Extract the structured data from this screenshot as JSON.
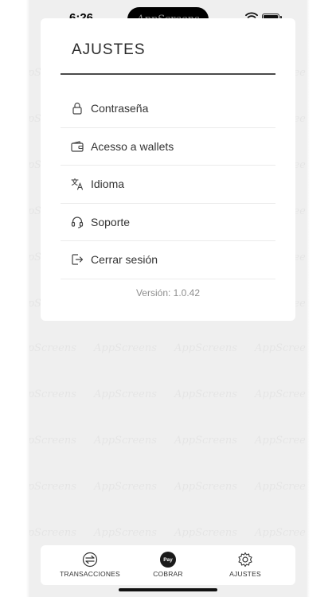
{
  "status_bar": {
    "time": "6:26",
    "island_text": "AppScreens"
  },
  "watermark": {
    "text": "AppScreens"
  },
  "settings": {
    "title": "AJUSTES",
    "items": [
      {
        "label": "Contraseña",
        "icon": "lock-icon"
      },
      {
        "label": "Acesso a wallets",
        "icon": "wallet-icon"
      },
      {
        "label": "Idioma",
        "icon": "translate-icon"
      },
      {
        "label": "Soporte",
        "icon": "headset-icon"
      },
      {
        "label": "Cerrar sesión",
        "icon": "logout-icon"
      }
    ],
    "version": "Versión: 1.0.42"
  },
  "tabbar": {
    "tabs": [
      {
        "label": "TRANSACCIONES",
        "icon": "transfer-icon"
      },
      {
        "label": "COBRAR",
        "icon": "pay-icon",
        "icon_text": "Pay"
      },
      {
        "label": "AJUSTES",
        "icon": "gear-icon"
      }
    ]
  },
  "colors": {
    "background": "#efefef",
    "card": "#ffffff",
    "text": "#333333",
    "muted": "#8e8e8e"
  }
}
